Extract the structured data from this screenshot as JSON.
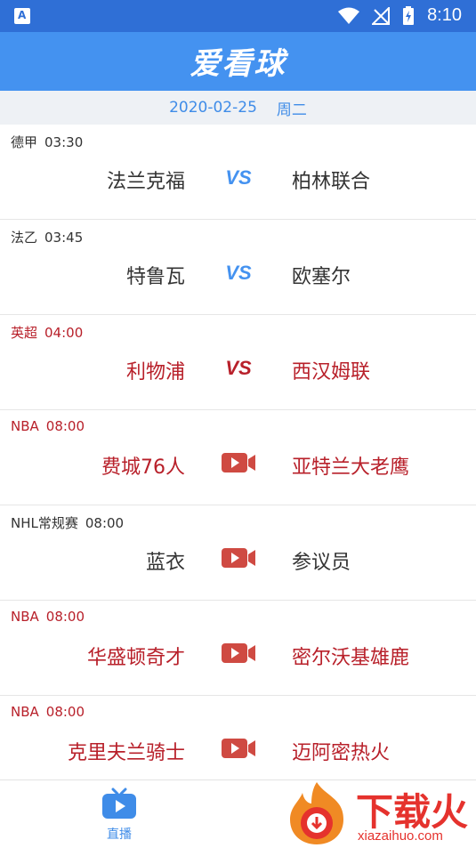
{
  "status_bar": {
    "time": "8:10"
  },
  "app": {
    "title": "爱看球"
  },
  "date": {
    "day": "2020-02-25",
    "weekday": "周二"
  },
  "colors": {
    "accent_blue": "#4492f0",
    "highlight_red": "#b8202a",
    "camera_red": "#cf4a42"
  },
  "matches": [
    {
      "league": "德甲",
      "time": "03:30",
      "home": "法兰克福",
      "away": "柏林联合",
      "center": "VS",
      "highlight": false
    },
    {
      "league": "法乙",
      "time": "03:45",
      "home": "特鲁瓦",
      "away": "欧塞尔",
      "center": "VS",
      "highlight": false
    },
    {
      "league": "英超",
      "time": "04:00",
      "home": "利物浦",
      "away": "西汉姆联",
      "center": "VS",
      "highlight": true
    },
    {
      "league": "NBA",
      "time": "08:00",
      "home": "费城76人",
      "away": "亚特兰大老鹰",
      "center_icon": "video-camera-icon",
      "highlight": true
    },
    {
      "league": "NHL常规赛",
      "time": "08:00",
      "home": "蓝衣",
      "away": "参议员",
      "center_icon": "video-camera-icon",
      "highlight": false
    },
    {
      "league": "NBA",
      "time": "08:00",
      "home": "华盛顿奇才",
      "away": "密尔沃基雄鹿",
      "center_icon": "video-camera-icon",
      "highlight": true
    },
    {
      "league": "NBA",
      "time": "08:00",
      "home": "克里夫兰骑士",
      "away": "迈阿密热火",
      "center_icon": "video-camera-icon",
      "highlight": true
    }
  ],
  "bottom_nav": {
    "live_label": "直播",
    "live_icon": "tv-icon"
  },
  "watermark": {
    "text": "下载火",
    "url": "xiazaihuo.com"
  }
}
